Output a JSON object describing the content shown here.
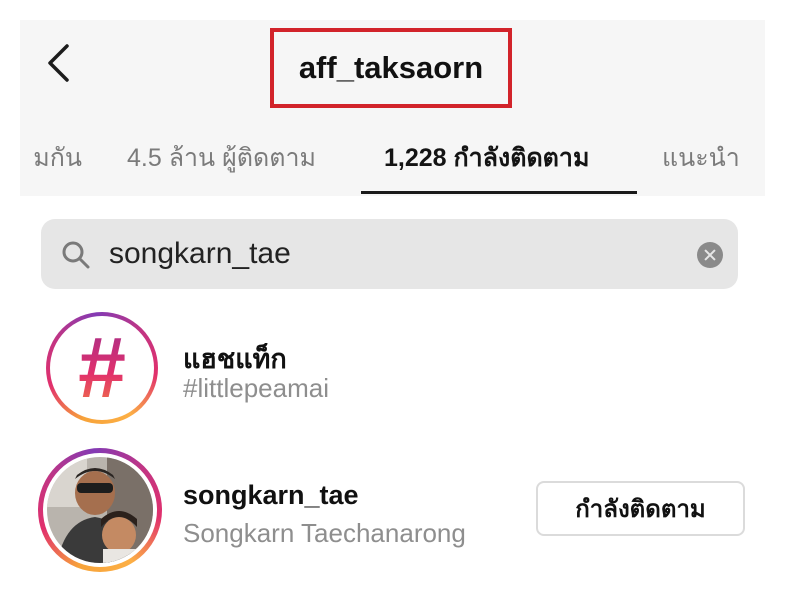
{
  "header": {
    "username": "aff_taksaorn"
  },
  "tabs": [
    {
      "label": "มกัน"
    },
    {
      "label": "4.5 ล้าน ผู้ติดตาม"
    },
    {
      "label": "1,228 กำลังติดตาม"
    },
    {
      "label": "แนะนำ"
    }
  ],
  "search": {
    "value": "songkarn_tae"
  },
  "results": [
    {
      "title": "แฮชแท็ก",
      "subtitle": "#littlepeamai",
      "icon": "hashtag-icon"
    },
    {
      "title": "songkarn_tae",
      "subtitle": "Songkarn Taechanarong",
      "button_label": "กำลังติดตาม"
    }
  ],
  "colors": {
    "highlight_box": "#d2232a",
    "story_ring_start": "#f7a33a",
    "story_ring_end": "#c13584"
  }
}
